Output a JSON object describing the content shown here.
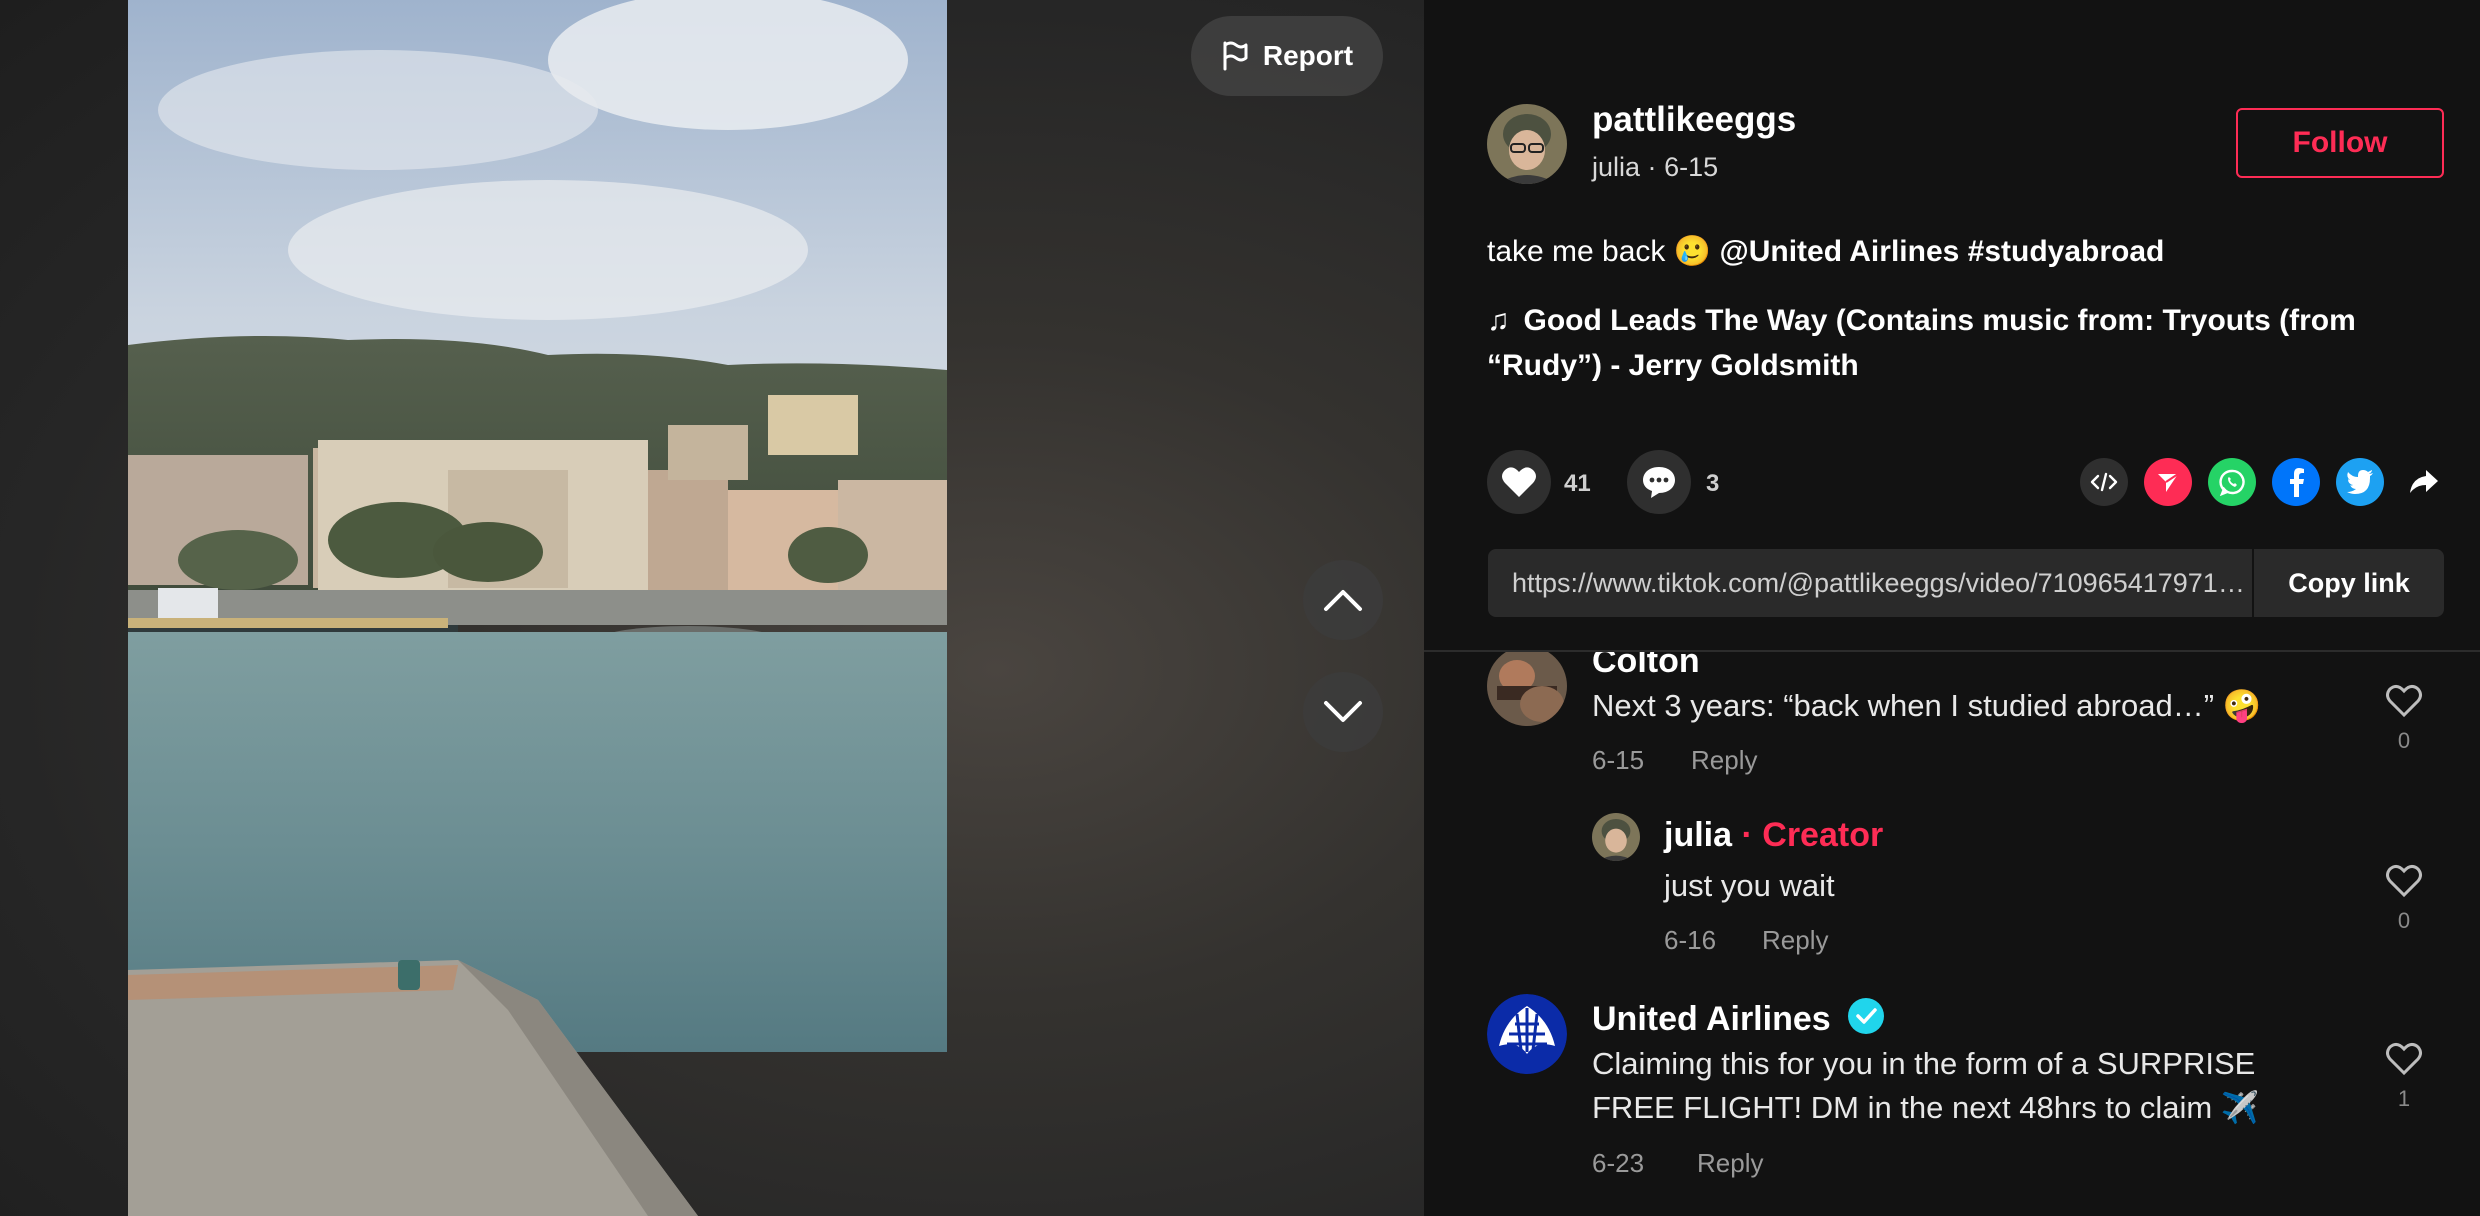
{
  "video": {
    "report_label": "Report"
  },
  "author": {
    "username": "pattlikeeggs",
    "display_name": "julia",
    "date": "6-15",
    "follow_label": "Follow"
  },
  "caption": {
    "text": "take me back",
    "emoji": "🥲",
    "mention": "@United Airlines",
    "hashtag": "#studyabroad"
  },
  "music": {
    "icon": "music-note-icon",
    "title": "Good Leads The Way (Contains music from: Tryouts (from “Rudy”) - Jerry Goldsmith"
  },
  "stats": {
    "likes": "41",
    "comments": "3"
  },
  "share": {
    "icons": [
      "embed-icon",
      "send-icon",
      "whatsapp-icon",
      "facebook-icon",
      "twitter-icon",
      "share-arrow-icon"
    ],
    "colors": {
      "send": "#fe2c55",
      "whatsapp": "#25d366",
      "facebook": "#0075fa",
      "twitter": "#1da1f2"
    }
  },
  "link": {
    "url": "https://www.tiktok.com/@pattlikeeggs/video/7109654179716...",
    "copy_label": "Copy link"
  },
  "comments": [
    {
      "name": "Colton",
      "text": "Next 3 years: “back when I studied abroad…” 🤪",
      "date": "6-15",
      "reply_label": "Reply",
      "likes": "0"
    },
    {
      "name": "julia",
      "separator": "·",
      "badge": "Creator",
      "text": "just you wait",
      "date": "6-16",
      "reply_label": "Reply",
      "likes": "0"
    },
    {
      "name": "United Airlines",
      "verified": true,
      "text": "Claiming this for you in the form of a SURPRISE FREE FLIGHT! DM in the next 48hrs to claim ✈️",
      "date": "6-23",
      "reply_label": "Reply",
      "likes": "1"
    }
  ],
  "colors": {
    "accent": "#fe2c55",
    "background": "#121212"
  }
}
